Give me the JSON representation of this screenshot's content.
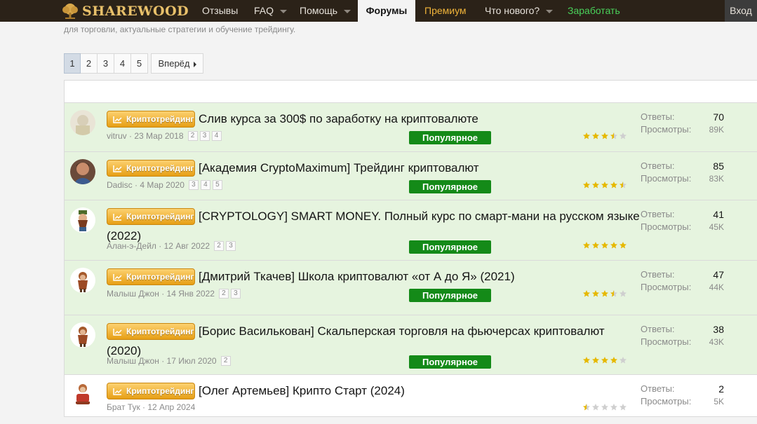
{
  "nav": {
    "logo_text": "SHAREWOOD",
    "items": [
      "Отзывы",
      "FAQ",
      "Помощь",
      "Форумы",
      "Премиум",
      "Что нового?",
      "Заработать",
      "Вход"
    ]
  },
  "subtitle": "для торговли, актуальные стратегии и обучение трейдингу.",
  "pagination": {
    "pages": [
      "1",
      "2",
      "3",
      "4",
      "5"
    ],
    "current": "1",
    "next_label": "Вперёд"
  },
  "labels": {
    "answers": "Ответы:",
    "views": "Просмотры:",
    "popular": "Популярное"
  },
  "threads": [
    {
      "prefix": "Криптотрейдинг",
      "title": "Слив курса за 300$ по заработку на криптовалюте",
      "author": "vitruv",
      "date": "23 Мар 2018",
      "pages": [
        "2",
        "3",
        "4"
      ],
      "popular": true,
      "rating": 3.5,
      "answers": "70",
      "views": "89K"
    },
    {
      "prefix": "Криптотрейдинг",
      "title": "[Академия CryptoMaximum] Трейдинг криптовалют",
      "author": "Dadisc",
      "date": "4 Мар 2020",
      "pages": [
        "3",
        "4",
        "5"
      ],
      "popular": true,
      "rating": 4.5,
      "answers": "85",
      "views": "83K"
    },
    {
      "prefix": "Криптотрейдинг",
      "title": "[CRYPTOLOGY] SMART MONEY. Полный курс по смарт-мани на русском языке (2022)",
      "author": "Алан-э-Дейл",
      "date": "12 Авг 2022",
      "pages": [
        "2",
        "3"
      ],
      "popular": true,
      "rating": 5,
      "answers": "41",
      "views": "45K"
    },
    {
      "prefix": "Криптотрейдинг",
      "title": "[Дмитрий Ткачев] Школа криптовалют «от А до Я» (2021)",
      "author": "Малыш Джон",
      "date": "14 Янв 2022",
      "pages": [
        "2",
        "3"
      ],
      "popular": true,
      "rating": 3.5,
      "answers": "47",
      "views": "44K"
    },
    {
      "prefix": "Криптотрейдинг",
      "title": "[Борис Васильковaн] Скальперская торговля на фьючерсах криптовалют (2020)",
      "author": "Малыш Джон",
      "date": "17 Июл 2020",
      "pages": [
        "2"
      ],
      "popular": true,
      "rating": 4,
      "answers": "38",
      "views": "43K"
    },
    {
      "prefix": "Криптотрейдинг",
      "title": "[Олег Артемьев] Крипто Старт (2024)",
      "author": "Брат Тук",
      "date": "12 Апр 2024",
      "pages": [],
      "popular": false,
      "rating": 0.5,
      "answers": "2",
      "views": "5K"
    }
  ]
}
